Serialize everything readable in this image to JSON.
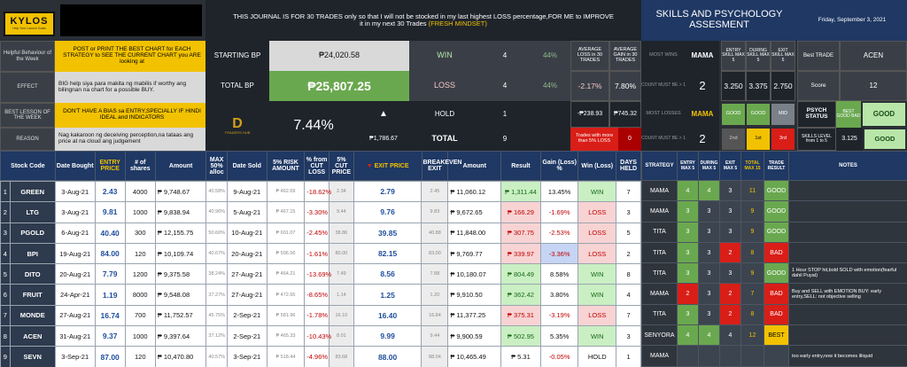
{
  "logo": {
    "text": "KYLOS",
    "subtitle": "Help Your Launch Goals"
  },
  "journal_note": "THIS JOURNAL IS FOR 30 TRADES only so that I will not be stocked in my last highest LOSS percentage,FOR ME  to IMPROVE it in my next 30 Trades",
  "journal_note_highlight": "(FRESH MINDSET)",
  "skills_title": "SKILLS AND PSYCHOLOGY ASSESMENT",
  "date": "Friday, September 3, 2021",
  "left_panel": {
    "helpful_label": "Helpful Behaviour of the Week",
    "helpful_text": "POST or PRINT THE BEST CHART for EACH STRATEGY to SEE THE CURRENT CHART you ARE looking at",
    "effect_label": "EFFECT",
    "effect_text": "BIG help siya para makita ng mabilis if worthy ang bilingnan na chart for a possible BUY.",
    "lesson_label": "BEST LESSON OF THE WEEK",
    "lesson_text": "DON'T HAVE A BIAS sa ENTRY,SPECIALLY IF HINDI IDEAL and INDICATORS",
    "reason_label": "REASON",
    "reason_text": "Nag kakaroon ng deceiving perception,na tataas ang price at na cloud ang judgement"
  },
  "summary": {
    "starting_bp_label": "STARTING BP",
    "starting_bp": "₱24,020.58",
    "total_bp_label": "TOTAL BP",
    "total_bp": "₱25,807.25",
    "percent": "7.44%",
    "gain": "₱1,786.67",
    "logo_text": "TRADERS HUB",
    "win_label": "WIN",
    "win_count": "4",
    "win_pct": "44%",
    "loss_label": "LOSS",
    "loss_count": "4",
    "loss_pct": "44%",
    "hold_label": "HOLD",
    "hold_count": "1",
    "total_label": "TOTAL",
    "total_count": "9",
    "avg_loss_label": "AVERAGE LOSS in 30 TRADES",
    "avg_gain_label": "AVERAGE GAIN in 30 TRADES",
    "avg_loss": "-2.17%",
    "avg_gain": "7.80%",
    "loss_amt": "-₱238.93",
    "gain_amt": "₱745.32",
    "trades_note": "Trades with more than 5% LOSS",
    "trades_note_val": "0"
  },
  "skills": {
    "most_wins_label": "MOST WINS",
    "most_wins": "MAMA",
    "count1_label": "COUNT MUST BE > 1",
    "count1": "2",
    "most_losses_label": "MOST LOSSES",
    "most_losses": "MAMA",
    "count2_label": "COUNT MUST BE > 1",
    "count2": "2",
    "entry_label": "ENTRY SKILL MAX 5",
    "during_label": "DURING SKILL MAX 5",
    "exit_label": "EXIT SKILL MAX 5",
    "entry": "3.250",
    "during": "3.375",
    "exit": "2.750",
    "good1": "GOOD",
    "good2": "GOOD",
    "mid": "MID",
    "rank1": "2nd",
    "rank2": "1st",
    "rank3": "3rd",
    "best_trade_label": "Best TRADE",
    "best_trade": "ACEN",
    "score_label": "Score",
    "score": "12",
    "psych_label": "PSYCH STATUS",
    "psych_best": "BEST GOOD BAD",
    "psych_val": "GOOD",
    "level_label": "SKILLS LEVEL from 1 to 5",
    "level": "3.125",
    "level_val": "GOOD"
  },
  "headers": [
    "Stock Code",
    "Date Bought",
    "ENTRY PRICE",
    "# of shares",
    "Amount",
    "MAX 50% alloc",
    "Date Sold",
    "5% RISK AMOUNT",
    "% from CUT LOSS",
    "5% CUT PRICE",
    "EXIT PRICE",
    "BREAKEVEN EXIT",
    "Amount",
    "Result",
    "Gain (Loss) %",
    "Win (Loss)",
    "DAYS HELD"
  ],
  "right_headers": [
    "STRATEGY",
    "ENTRY MAX 5",
    "DURING MAX 5",
    "EXIT MAX 5",
    "TOTAL MAX 15",
    "TRADE RESULT",
    "NOTES"
  ],
  "rows": [
    {
      "n": "1",
      "code": "GREEN",
      "bought": "3-Aug-21",
      "entry": "2.43",
      "shares": "4000",
      "amount": "₱ 9,748.67",
      "alloc": "40.58%",
      "sold": "9-Aug-21",
      "risk": "₱ 462.69",
      "cut": "-18.62%",
      "cutp": "2.34",
      "exit": "2.79",
      "be": "2.45",
      "amt2": "₱ 11,060.12",
      "result": "₱ 1,311.44",
      "gain": "13.45%",
      "wl": "WIN",
      "days": "7",
      "strat": "MAMA",
      "e": "4",
      "d": "4",
      "x": "3",
      "t": "11",
      "tr": "GOOD",
      "note": ""
    },
    {
      "n": "2",
      "code": "LTG",
      "bought": "3-Aug-21",
      "entry": "9.81",
      "shares": "1000",
      "amount": "₱ 9,838.94",
      "alloc": "40.96%",
      "sold": "5-Aug-21",
      "risk": "₱ 467.15",
      "cut": "-3.30%",
      "cutp": "9.44",
      "exit": "9.76",
      "be": "9.83",
      "amt2": "₱ 9,672.65",
      "result": "₱ 166.29",
      "gain": "-1.69%",
      "wl": "LOSS",
      "days": "3",
      "strat": "MAMA",
      "e": "3",
      "d": "3",
      "x": "3",
      "t": "9",
      "tr": "GOOD",
      "note": ""
    },
    {
      "n": "3",
      "code": "PGOLD",
      "bought": "6-Aug-21",
      "entry": "40.40",
      "shares": "300",
      "amount": "₱ 12,155.75",
      "alloc": "50.60%",
      "sold": "10-Aug-21",
      "risk": "₱ 601.07",
      "cut": "-2.45%",
      "cutp": "38.86",
      "exit": "39.85",
      "be": "40.88",
      "amt2": "₱ 11,848.00",
      "result": "₱ 307.75",
      "gain": "-2.53%",
      "wl": "LOSS",
      "days": "5",
      "strat": "TITA",
      "e": "3",
      "d": "3",
      "x": "3",
      "t": "9",
      "tr": "GOOD",
      "note": ""
    },
    {
      "n": "4",
      "code": "BPI",
      "bought": "19-Aug-21",
      "entry": "84.00",
      "shares": "120",
      "amount": "₱ 10,109.74",
      "alloc": "40.67%",
      "sold": "20-Aug-21",
      "risk": "₱ 506.56",
      "cut": "-1.61%",
      "cutp": "80.00",
      "exit": "82.15",
      "be": "83.00",
      "amt2": "₱ 9,769.77",
      "result": "₱ 339.97",
      "gain": "-3.36%",
      "wl": "LOSS",
      "days": "2",
      "strat": "TITA",
      "e": "3",
      "d": "3",
      "x": "2",
      "t": "8",
      "tr": "BAD",
      "note": ""
    },
    {
      "n": "5",
      "code": "DITO",
      "bought": "20-Aug-21",
      "entry": "7.79",
      "shares": "1200",
      "amount": "₱ 9,375.58",
      "alloc": "38.24%",
      "sold": "27-Aug-21",
      "risk": "₱ 464.21",
      "cut": "-13.69%",
      "cutp": "7.49",
      "exit": "8.56",
      "be": "7.88",
      "amt2": "₱ 10,180.07",
      "result": "₱ 804.49",
      "gain": "8.58%",
      "wl": "WIN",
      "days": "8",
      "strat": "TITA",
      "e": "3",
      "d": "3",
      "x": "3",
      "t": "9",
      "tr": "GOOD",
      "note": "1 Hour STOP hit,bold SOLD with emotion(fearful dahil Puyat)"
    },
    {
      "n": "6",
      "code": "FRUIT",
      "bought": "24-Apr-21",
      "entry": "1.19",
      "shares": "8000",
      "amount": "₱ 9,548.08",
      "alloc": "37.27%",
      "sold": "27-Aug-21",
      "risk": "₱ 472.65",
      "cut": "-8.65%",
      "cutp": "1.14",
      "exit": "1.25",
      "be": "1.20",
      "amt2": "₱ 9,910.50",
      "result": "₱ 362.42",
      "gain": "3.80%",
      "wl": "WIN",
      "days": "4",
      "strat": "MAMA",
      "e": "2",
      "d": "3",
      "x": "2",
      "t": "7",
      "tr": "BAD",
      "note": "Buy and SELL with EMOTION BUY: early entry,SELL: not objective selling"
    },
    {
      "n": "7",
      "code": "MONDE",
      "bought": "27-Aug-21",
      "entry": "16.74",
      "shares": "700",
      "amount": "₱ 11,752.57",
      "alloc": "45.75%",
      "sold": "2-Sep-21",
      "risk": "₱ 581.96",
      "cut": "-1.78%",
      "cutp": "16.10",
      "exit": "16.40",
      "be": "16.84",
      "amt2": "₱ 11,377.25",
      "result": "₱ 375.31",
      "gain": "-3.19%",
      "wl": "LOSS",
      "days": "7",
      "strat": "TITA",
      "e": "3",
      "d": "3",
      "x": "2",
      "t": "8",
      "tr": "BAD",
      "note": ""
    },
    {
      "n": "8",
      "code": "ACEN",
      "bought": "31-Aug-21",
      "entry": "9.37",
      "shares": "1000",
      "amount": "₱ 9,397.64",
      "alloc": "37.12%",
      "sold": "2-Sep-21",
      "risk": "₱ 465.33",
      "cut": "-10.43%",
      "cutp": "8.01",
      "exit": "9.99",
      "be": "9.44",
      "amt2": "₱ 9,900.59",
      "result": "₱ 502.95",
      "gain": "5.35%",
      "wl": "WIN",
      "days": "3",
      "strat": "SENYORA",
      "e": "4",
      "d": "4",
      "x": "4",
      "t": "12",
      "tr": "BEST",
      "note": ""
    },
    {
      "n": "9",
      "code": "SEVN",
      "bought": "3-Sep-21",
      "entry": "87.00",
      "shares": "120",
      "amount": "₱ 10,470.80",
      "alloc": "40.57%",
      "sold": "3-Sep-21",
      "risk": "₱ 518.44",
      "cut": "-4.96%",
      "cutp": "83.68",
      "exit": "88.00",
      "be": "88.04",
      "amt2": "₱ 10,465.49",
      "result": "₱ 5.31",
      "gain": "-0.05%",
      "wl": "HOLD",
      "days": "1",
      "strat": "MAMA",
      "e": "",
      "d": "",
      "x": "",
      "t": "",
      "tr": "",
      "note": "too early entry,now it becomes illiquid"
    }
  ]
}
